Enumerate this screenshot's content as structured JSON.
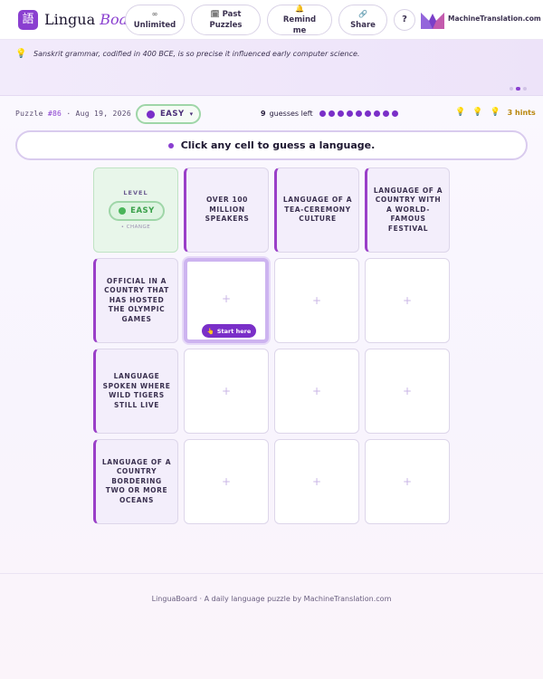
{
  "header": {
    "logo_glyph": "語",
    "brand_part1": "Lingua",
    "brand_part2": "Board",
    "buttons": [
      {
        "icon": "∞",
        "label": "Unlimited"
      },
      {
        "icon": "🗓",
        "label": "Past Puzzles"
      },
      {
        "icon": "🔔",
        "label": "Remind me"
      },
      {
        "icon": "🔗",
        "label": "Share"
      }
    ],
    "help_label": "?",
    "partner": "MachineTranslation.com"
  },
  "fact": {
    "icon": "💡",
    "text": "Sanskrit grammar, codified in 400 BCE, is so precise it influenced early computer science.",
    "pager_total": 3,
    "pager_active": 2
  },
  "puzzle": {
    "label": "Puzzle",
    "number": "#86",
    "date": "· Aug 19, 2026",
    "difficulty": "EASY",
    "guesses_left": "9",
    "guesses_label": "guesses left",
    "guess_dots": 9,
    "hints_label": "3 hints",
    "hint_bulbs": 3
  },
  "instruction": "Click any cell to guess a language.",
  "grid": {
    "level_label": "LEVEL",
    "level_value": "EASY",
    "level_change": "• CHANGE",
    "columns": [
      "Over 100 million speakers",
      "Language of a tea-ceremony culture",
      "Language of a country with a world-famous festival"
    ],
    "rows": [
      "Official in a country that has hosted the Olympic Games",
      "Language spoken where wild tigers still live",
      "Language of a country bordering two or more oceans"
    ],
    "plus": "+",
    "start_here": "Start here",
    "start_icon": "👆"
  },
  "footer": "LinguaBoard · A daily language puzzle by MachineTranslation.com",
  "colors": {
    "accent": "#8a3fd0",
    "easy_green": "#4ab55a",
    "hint_gold": "#b8860b"
  }
}
